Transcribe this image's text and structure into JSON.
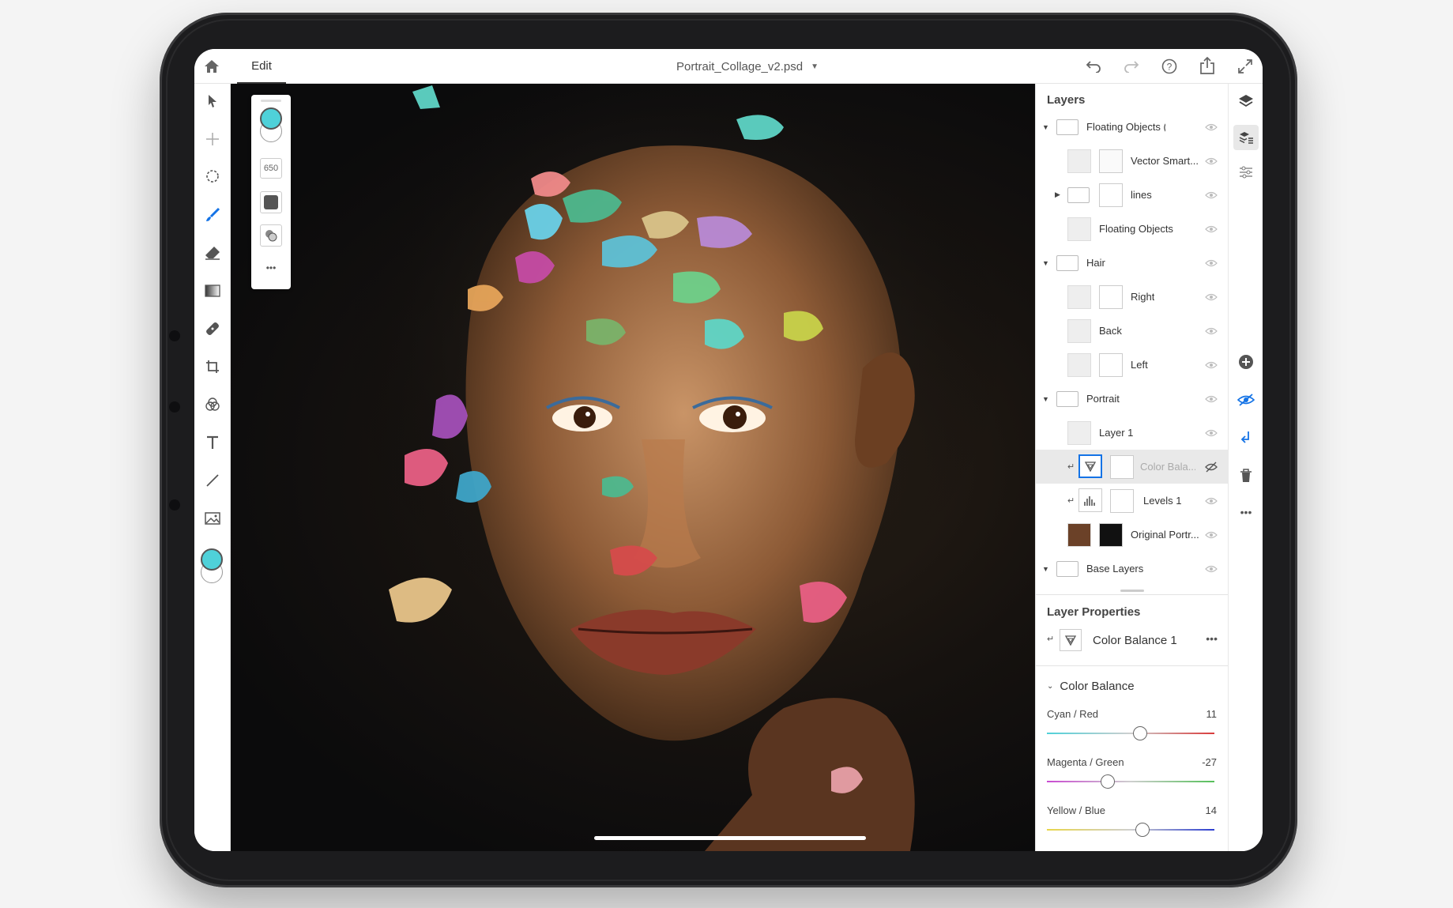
{
  "topbar": {
    "tab_edit": "Edit",
    "document_title": "Portrait_Collage_v2.psd",
    "icons": [
      "home-icon",
      "undo-icon",
      "redo-icon",
      "help-icon",
      "share-icon",
      "fullscreen-icon"
    ]
  },
  "toolbar": {
    "tools": [
      "select-icon",
      "move-icon",
      "lasso-icon",
      "brush-icon",
      "eraser-icon",
      "gradient-icon",
      "healing-icon",
      "crop-icon",
      "adjustments-icon",
      "type-icon",
      "line-icon",
      "place-image-icon"
    ],
    "foreground_color": "#4fd1d9",
    "background_color": "#ffffff"
  },
  "tool_options": {
    "brush_size": "650",
    "more_label": "•••"
  },
  "layers_panel": {
    "title": "Layers",
    "layers": [
      {
        "name": "Floating Objects (alway...",
        "type": "group",
        "expanded": true
      },
      {
        "name": "Vector Smart...",
        "type": "layer"
      },
      {
        "name": "lines",
        "type": "group",
        "expanded": false
      },
      {
        "name": "Floating Objects",
        "type": "layer"
      },
      {
        "name": "Hair",
        "type": "group",
        "expanded": true
      },
      {
        "name": "Right",
        "type": "layer"
      },
      {
        "name": "Back",
        "type": "layer"
      },
      {
        "name": "Left",
        "type": "layer"
      },
      {
        "name": "Portrait",
        "type": "group",
        "expanded": true
      },
      {
        "name": "Layer 1",
        "type": "layer"
      },
      {
        "name": "Color Bala...",
        "type": "adjustment",
        "selected": true,
        "hidden": true
      },
      {
        "name": "Levels 1",
        "type": "adjustment"
      },
      {
        "name": "Original Portr...",
        "type": "layer"
      },
      {
        "name": "Base Layers",
        "type": "group",
        "expanded": true
      }
    ]
  },
  "layer_properties": {
    "title": "Layer Properties",
    "layer_name": "Color Balance 1",
    "more_label": "•••",
    "section_title": "Color Balance",
    "sliders": [
      {
        "label": "Cyan / Red",
        "value": "11",
        "level": 11,
        "range": [
          -100,
          100
        ],
        "from": "#4fd1d9",
        "to": "#d93b3b"
      },
      {
        "label": "Magenta / Green",
        "value": "-27",
        "level": -27,
        "range": [
          -100,
          100
        ],
        "from": "#c94bd1",
        "to": "#56c05a"
      },
      {
        "label": "Yellow / Blue",
        "value": "14",
        "level": 14,
        "range": [
          -100,
          100
        ],
        "from": "#e8d64a",
        "to": "#2d3fd1"
      }
    ]
  },
  "right_rail": {
    "icons": [
      "layers-icon",
      "layer-properties-icon",
      "adjust-settings-icon",
      "add-layer-icon",
      "visibility-icon",
      "clip-icon",
      "delete-icon",
      "more-icon"
    ]
  }
}
